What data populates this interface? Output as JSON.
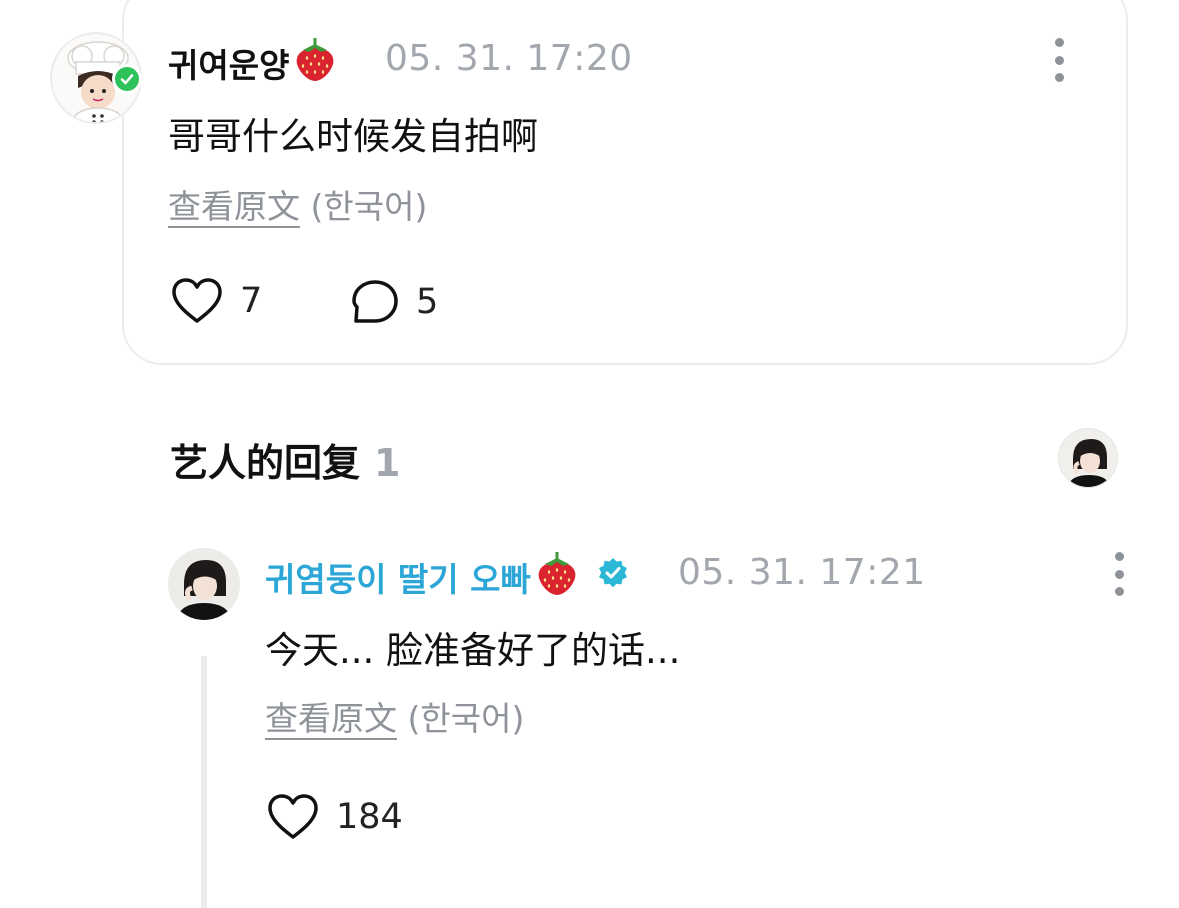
{
  "comment": {
    "username": "귀여운양",
    "username_emoji": "🍓",
    "timestamp": "05. 31. 17:20",
    "text": "哥哥什么时候发自拍啊",
    "translate_link": "查看原文",
    "translate_lang": "(한국어)",
    "likes": "7",
    "replies": "5",
    "badge_color": "#2fc25b"
  },
  "artist_section": {
    "title": "艺人的回复",
    "count": "1"
  },
  "reply": {
    "username": "귀염둥이 딸기 오빠",
    "username_emoji": "🍓",
    "timestamp": "05. 31. 17:21",
    "text": "今天... 脸准备好了的话...",
    "translate_link": "查看原文",
    "translate_lang": "(한국어)",
    "likes": "184",
    "name_color": "#2ba6d6",
    "verified_color": "#2bb7d6"
  },
  "icons": {
    "like": "heart-outline-icon",
    "reply": "speech-bubble-icon",
    "more": "more-vertical-icon",
    "verified": "verified-badge-icon",
    "emoji": "strawberry-emoji"
  }
}
